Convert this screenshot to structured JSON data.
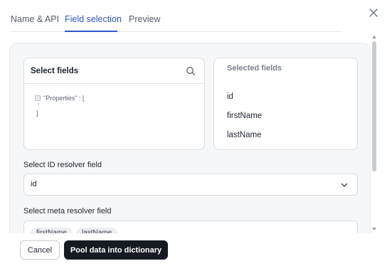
{
  "tabs": [
    {
      "label": "Name & API"
    },
    {
      "label": "Field selection"
    },
    {
      "label": "Preview"
    }
  ],
  "active_tab": "Field selection",
  "select_fields": {
    "title": "Select fields",
    "tree_open": "\"Properties\" : [",
    "tree_close": "]"
  },
  "selected_fields": {
    "title": "Selected fields",
    "items": [
      "id",
      "firstName",
      "lastName"
    ]
  },
  "id_resolver": {
    "label": "Select ID resolver field",
    "value": "id"
  },
  "meta_resolver": {
    "label": "Select meta resolver field",
    "chips": [
      "firstName",
      "lastName"
    ]
  },
  "footer": {
    "cancel_label": "Cancel",
    "primary_label": "Pool data into dictionary"
  },
  "icons": {
    "close": "close-icon",
    "search": "search-icon",
    "chevron": "chevron-down-icon"
  },
  "colors": {
    "accent": "#2f56c9",
    "primary_button": "#161a22"
  }
}
